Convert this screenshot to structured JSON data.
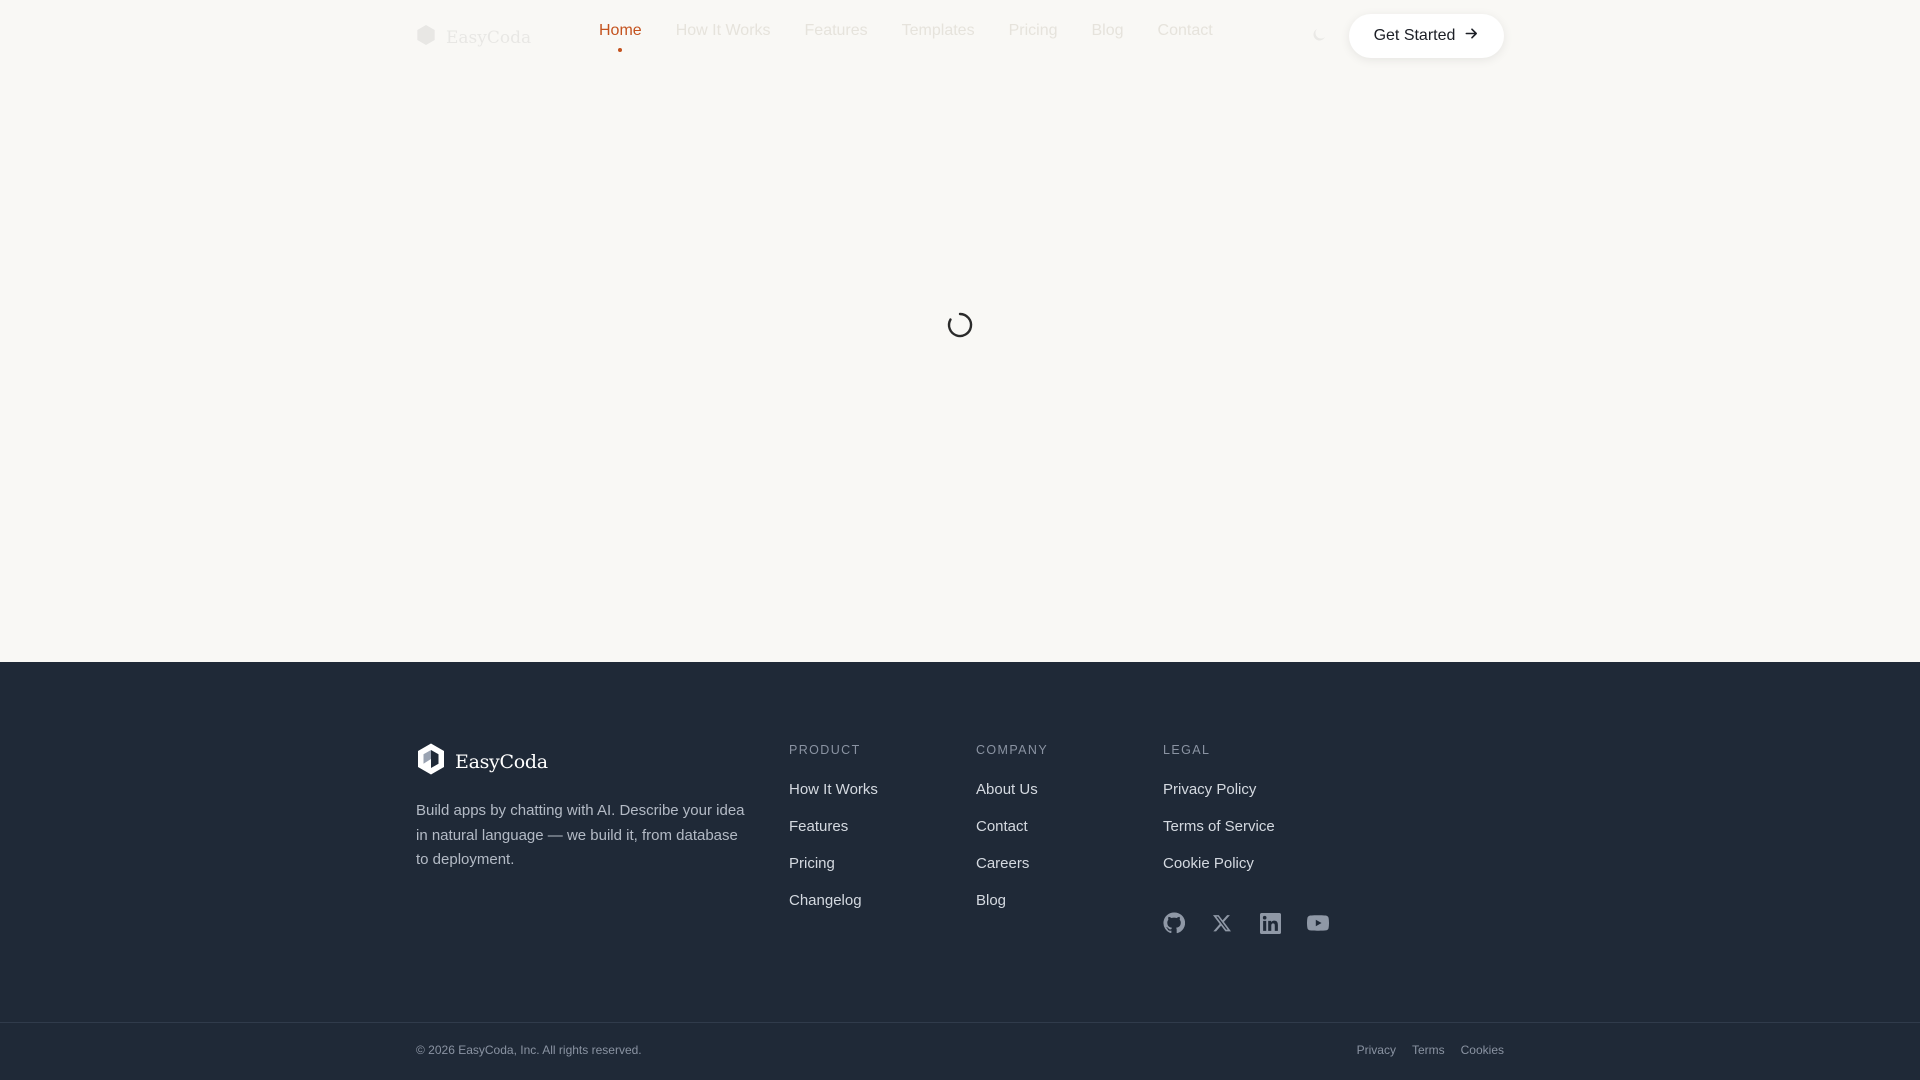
{
  "header": {
    "logo_text": "EasyCoda",
    "nav": [
      {
        "label": "Home",
        "active": true
      },
      {
        "label": "How It Works"
      },
      {
        "label": "Features"
      },
      {
        "label": "Templates"
      },
      {
        "label": "Pricing"
      },
      {
        "label": "Blog"
      },
      {
        "label": "Contact"
      }
    ],
    "cta_label": "Get Started",
    "cta_icon": "arrow-right-icon",
    "accent_color": "#c4531f"
  },
  "main": {
    "state": "loading",
    "spinner_icon": "loading-spinner-icon"
  },
  "footer": {
    "brand_name": "EasyCoda",
    "brand_description": "Build apps by chatting with AI. Describe your idea in natural language — we build it, from database to deployment.",
    "columns": [
      {
        "title": "PRODUCT",
        "links": [
          "How It Works",
          "Features",
          "Pricing",
          "Changelog"
        ]
      },
      {
        "title": "COMPANY",
        "links": [
          "About Us",
          "Contact",
          "Careers",
          "Blog"
        ]
      },
      {
        "title": "LEGAL",
        "links": [
          "Privacy Policy",
          "Terms of Service",
          "Cookie Policy"
        ]
      }
    ],
    "social_icons": [
      "github-icon",
      "x-icon",
      "linkedin-icon",
      "youtube-icon"
    ],
    "copyright": "© 2026 EasyCoda, Inc. All rights reserved.",
    "bottom_links": [
      "Privacy",
      "Terms",
      "Cookies"
    ],
    "background_color": "#1f2937"
  }
}
